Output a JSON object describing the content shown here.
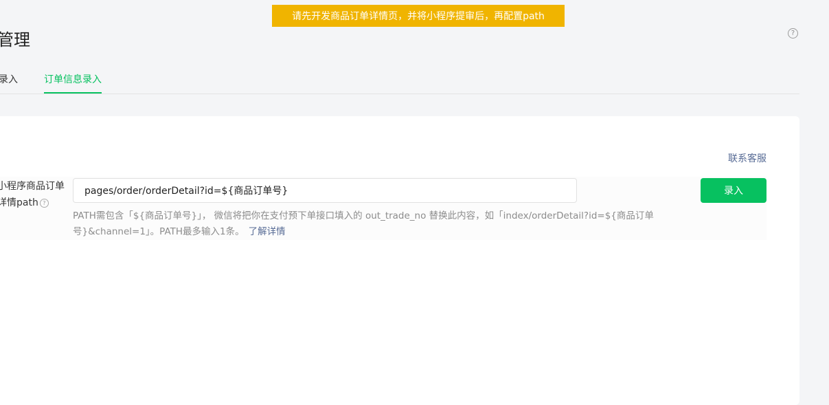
{
  "banner": {
    "text": "请先开发商品订单详情页，并将小程序提审后，再配置path"
  },
  "header": {
    "title": "管理",
    "help_icon": "?"
  },
  "tabs": [
    {
      "label": "录入"
    },
    {
      "label": "订单信息录入",
      "active": true
    }
  ],
  "form": {
    "contact_link": "联系客服",
    "field_label_line1": "小程序商品订单",
    "field_label_line2": "详情path",
    "field_help_icon": "?",
    "path_value": "pages/order/orderDetail?id=${商品订单号}",
    "submit_label": "录入",
    "tip_text": "PATH需包含「${商品订单号}」， 微信将把你在支付预下单接口填入的 out_trade_no 替换此内容，如「index/orderDetail?id=${商品订单号}&channel=1」。PATH最多输入1条。",
    "tip_link": "了解详情"
  },
  "colors": {
    "accent": "#07c160",
    "banner": "#f0b400",
    "link": "#576b95"
  }
}
